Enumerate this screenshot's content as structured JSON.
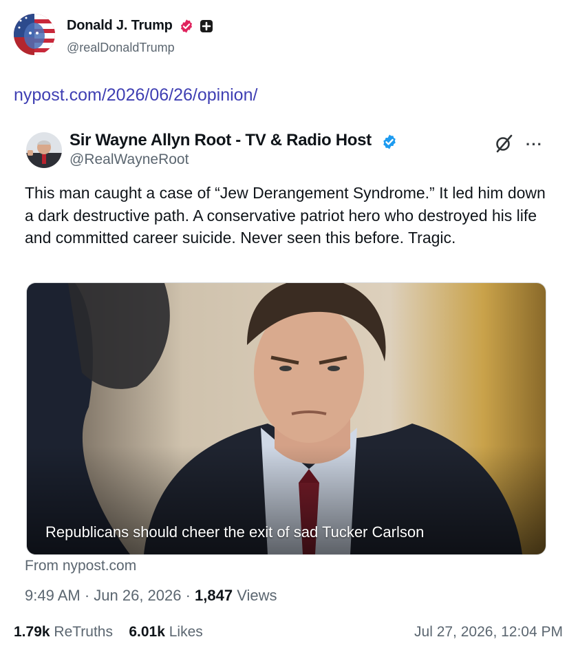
{
  "post": {
    "display_name": "Donald J. Trump",
    "handle": "@realDonaldTrump",
    "avatar_icon": "avatar-flag-portrait",
    "link_text": "nypost.com/2026/06/26/opinion/",
    "colors": {
      "link": "#3f3fb3",
      "verified_badge": "#e0245e",
      "muted_text": "#5b6670"
    }
  },
  "quote": {
    "display_name": "Sir Wayne Allyn Root - TV & Radio Host",
    "handle": "@RealWayneRoot",
    "body": "This man caught a case of “Jew Derangement Syndrome.” It led him down a dark destructive path. A conservative patriot hero who destroyed his life and committed career suicide. Never seen this before. Tragic.",
    "media_caption": "Republicans should cheer the exit of sad Tucker Carlson",
    "source_text": "From nypost.com",
    "time": "9:49 AM · Jun 26, 2026 · ",
    "views_count": "1,847",
    "views_label": " Views",
    "colors": {
      "verified_badge": "#1d9bf0"
    }
  },
  "footer": {
    "retruths_count": "1.79k",
    "retruths_label": "ReTruths",
    "likes_count": "6.01k",
    "likes_label": "Likes",
    "posted_at": "Jul 27, 2026, 12:04 PM"
  }
}
